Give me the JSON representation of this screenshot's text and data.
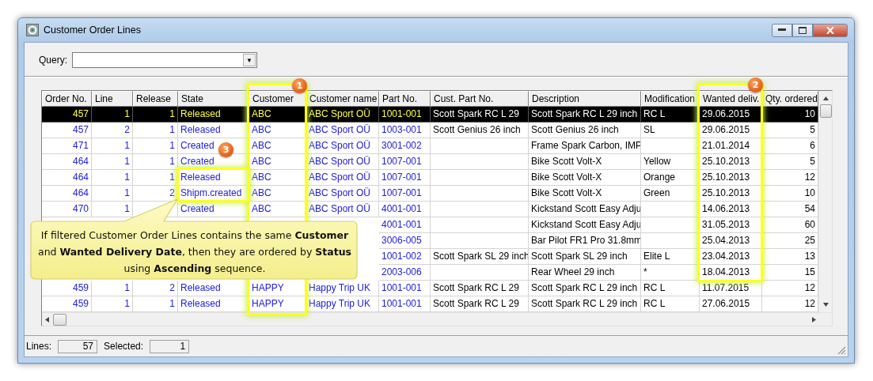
{
  "window": {
    "title": "Customer Order Lines"
  },
  "query": {
    "label": "Query:",
    "value_arrow": "▼"
  },
  "table": {
    "columns": [
      {
        "label": "Order No.",
        "kind": "key-number"
      },
      {
        "label": "Line",
        "kind": "key-number"
      },
      {
        "label": "Release",
        "kind": "key-number"
      },
      {
        "label": "State",
        "kind": "key-text"
      },
      {
        "label": "Customer",
        "kind": "key-text"
      },
      {
        "label": "Customer name",
        "kind": "key-text"
      },
      {
        "label": "Part No.",
        "kind": "key-text"
      },
      {
        "label": "Cust. Part No.",
        "kind": "text"
      },
      {
        "label": "Description",
        "kind": "text"
      },
      {
        "label": "Modification",
        "kind": "text"
      },
      {
        "label": "Wanted deliv.",
        "kind": "text"
      },
      {
        "label": "Qty. ordered",
        "kind": "number"
      }
    ],
    "rows": [
      {
        "selected": true,
        "cells": [
          "457",
          "1",
          "1",
          "Released",
          "ABC",
          "ABC Sport OÜ",
          "1001-001",
          "Scott Spark RC L 29",
          "Scott Spark RC L 29 inch",
          "RC L",
          "29.06.2015",
          "10"
        ]
      },
      {
        "selected": false,
        "cells": [
          "457",
          "2",
          "1",
          "Released",
          "ABC",
          "ABC Sport OÜ",
          "1003-001",
          "Scott Genius 26 inch",
          "Scott Genius 26 inch",
          "SL",
          "29.06.2015",
          "5"
        ]
      },
      {
        "selected": false,
        "cells": [
          "471",
          "1",
          "1",
          "Created",
          "ABC",
          "ABC Sport OÜ",
          "3001-002",
          null,
          "Frame Spark Carbon, IMP",
          null,
          "21.01.2014",
          "6"
        ]
      },
      {
        "selected": false,
        "cells": [
          "464",
          "1",
          "1",
          "Created",
          "ABC",
          "ABC Sport OÜ",
          "1007-001",
          null,
          "Bike Scott Volt-X",
          "Yellow",
          "25.10.2013",
          "5"
        ]
      },
      {
        "selected": false,
        "cells": [
          "464",
          "1",
          "1",
          "Released",
          "ABC",
          "ABC Sport OÜ",
          "1007-001",
          null,
          "Bike Scott Volt-X",
          "Orange",
          "25.10.2013",
          "12"
        ]
      },
      {
        "selected": false,
        "cells": [
          "464",
          "1",
          "2",
          "Shipm.created",
          "ABC",
          "ABC Sport OÜ",
          "1007-001",
          null,
          "Bike Scott Volt-X",
          "Green",
          "25.10.2013",
          "10"
        ]
      },
      {
        "selected": false,
        "cells": [
          "470",
          "1",
          null,
          "Created",
          "ABC",
          "ABC Sport OÜ",
          "4001-001",
          null,
          "Kickstand Scott Easy Adju",
          null,
          "14.06.2013",
          "54"
        ]
      },
      {
        "selected": false,
        "cells": [
          null,
          null,
          null,
          null,
          null,
          null,
          "4001-001",
          null,
          "Kickstand Scott Easy Adju",
          null,
          "31.05.2013",
          "60"
        ]
      },
      {
        "selected": false,
        "cells": [
          null,
          null,
          null,
          null,
          null,
          null,
          "3006-005",
          null,
          "Bar Pilot FR1 Pro 31.8mm",
          null,
          "25.04.2013",
          "25"
        ]
      },
      {
        "selected": false,
        "cells": [
          null,
          null,
          null,
          null,
          null,
          null,
          "1001-002",
          "Scott Spark SL 29 inch",
          "Scott Spark SL 29 inch",
          "Elite L",
          "23.04.2013",
          "13"
        ]
      },
      {
        "selected": false,
        "cells": [
          null,
          null,
          null,
          null,
          null,
          null,
          "2003-006",
          null,
          "Rear Wheel 29 inch",
          "*",
          "18.04.2013",
          "15"
        ]
      },
      {
        "selected": false,
        "cells": [
          "459",
          "1",
          "2",
          "Released",
          "HAPPY",
          "Happy Trip UK",
          "1001-001",
          "Scott Spark RC L 29",
          "Scott Spark RC L 29 inch",
          "RC L",
          "11.07.2015",
          "12"
        ]
      },
      {
        "selected": false,
        "cells": [
          "459",
          "1",
          "1",
          "Released",
          "HAPPY",
          "Happy Trip UK",
          "1001-001",
          "Scott Spark RC L 29",
          "Scott Spark RC L 29 inch",
          "RC L",
          "27.06.2015",
          "12"
        ]
      }
    ]
  },
  "annotations": [
    {
      "number": "1"
    },
    {
      "number": "2"
    },
    {
      "number": "3"
    }
  ],
  "callout": {
    "text": "If filtered Customer Order Lines contains the same **Customer** and **Wanted Delivery Date**, then they are ordered by **Status** using **Ascending** sequence."
  },
  "status_bar": {
    "fields": [
      {
        "label": "Lines:",
        "value": "57"
      },
      {
        "label": "Selected:",
        "value": "1"
      }
    ]
  }
}
